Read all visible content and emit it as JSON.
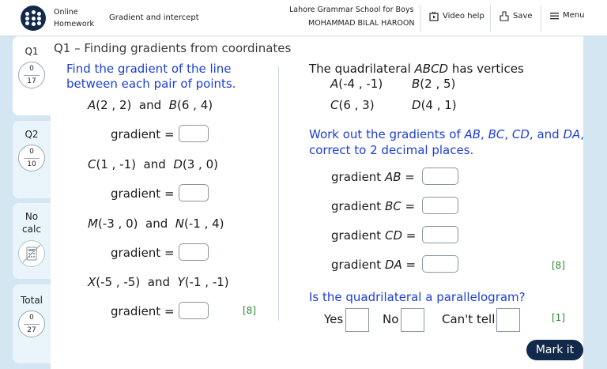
{
  "header": {
    "app_line1": "Online",
    "app_line2": "Homework",
    "topic": "Gradient and intercept",
    "school": "Lahore Grammar School for Boys",
    "student": "MOHAMMAD BILAL HAROON",
    "video_help": "Video help",
    "save": "Save",
    "menu": "Menu"
  },
  "sidebar": {
    "q1": {
      "label": "Q1",
      "score": "0",
      "total": "17"
    },
    "q2": {
      "label": "Q2",
      "score": "0",
      "total": "10"
    },
    "nocalc": {
      "line1": "No",
      "line2": "calc"
    },
    "total": {
      "label": "Total",
      "score": "0",
      "total": "27"
    }
  },
  "question": {
    "title": "Q1 – Finding gradients from coordinates",
    "left": {
      "instruction_line1": "Find the gradient of the line",
      "instruction_line2": "between each pair of points.",
      "pairs": [
        {
          "p1": "A",
          "c1": "(2 , 2)",
          "and": "and",
          "p2": "B",
          "c2": "(6 , 4)"
        },
        {
          "p1": "C",
          "c1": "(1 , -1)",
          "and": "and",
          "p2": "D",
          "c2": "(3 , 0)"
        },
        {
          "p1": "M",
          "c1": "(-3 , 0)",
          "and": "and",
          "p2": "N",
          "c2": "(-1 , 4)"
        },
        {
          "p1": "X",
          "c1": "(-5 , -5)",
          "and": "and",
          "p2": "Y",
          "c2": "(-1 , -1)"
        }
      ],
      "gradient_label": "gradient =",
      "marks": "[8]"
    },
    "right": {
      "intro_prefix": "The quadrilateral ",
      "intro_name": "ABCD",
      "intro_suffix": " has vertices",
      "vertices": [
        {
          "p": "A",
          "c": "(-4 , -1)"
        },
        {
          "p": "B",
          "c": "(2 , 5)"
        },
        {
          "p": "C",
          "c": "(6 , 3)"
        },
        {
          "p": "D",
          "c": "(4 , 1)"
        }
      ],
      "work_line1_prefix": "Work out the gradients of ",
      "seg_ab": "AB",
      "seg_bc": "BC",
      "seg_cd": "CD",
      "seg_da": "DA",
      "comma": ", ",
      "and_text": ", and ",
      "comma_end": ",",
      "work_line2": "correct to 2 decimal places.",
      "gradient_word": "gradient",
      "equals": " =",
      "marks_gradients": "[8]",
      "parallelogram_q": "Is the quadrilateral a parallelogram?",
      "yes": "Yes",
      "no": "No",
      "cant_tell": "Can't tell",
      "marks_parallelogram": "[1]"
    }
  },
  "mark_it": "Mark it"
}
